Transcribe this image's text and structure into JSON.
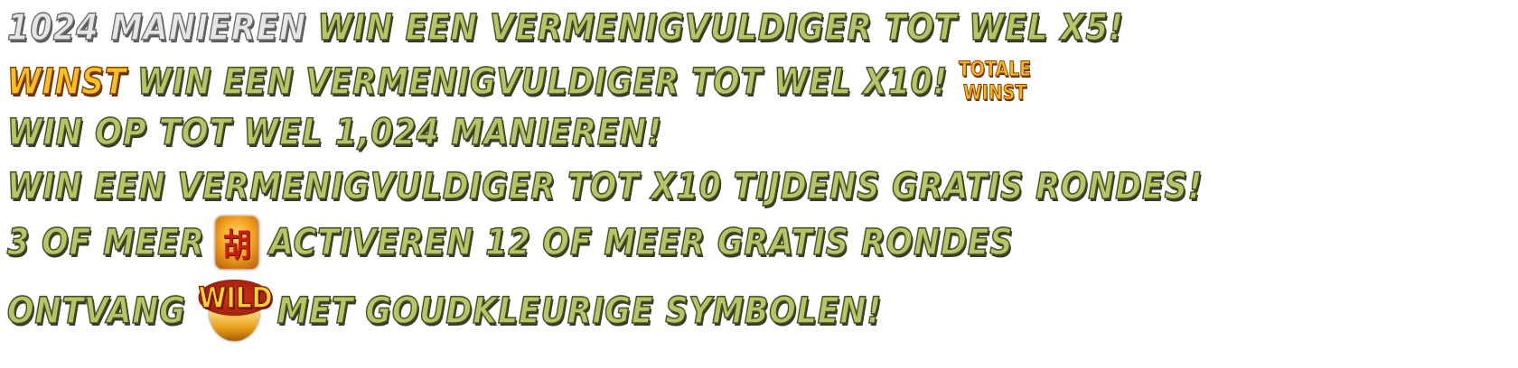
{
  "lines": [
    {
      "silver": "1024 MANIEREN",
      "green": "WIN EEN VERMENIGVULDIGER TOT WEL X5!"
    },
    {
      "gold": "WINST",
      "green": "WIN EEN VERMENIGVULDIGER TOT WEL X10!",
      "badge_top": "TOTALE",
      "badge_bottom": "WINST"
    },
    {
      "green": "WIN OP TOT WEL 1,024 MANIEREN!"
    },
    {
      "green": "WIN EEN VERMENIGVULDIGER TOT X10 TIJDENS GRATIS RONDES!"
    },
    {
      "green_a": "3 OF MEER",
      "symbol_glyph": "胡",
      "green_b": "ACTIVEREN 12 OF MEER GRATIS RONDES"
    },
    {
      "green_a": "ONTVANG",
      "wild_label": "WILD",
      "green_b": "MET GOUDKLEURIGE SYMBOLEN!"
    }
  ],
  "colors": {
    "green_text": "#b3c765",
    "silver_text": "#e6e6e6",
    "gold_text": "#f7c21f",
    "symbol_red": "#c81f10"
  }
}
